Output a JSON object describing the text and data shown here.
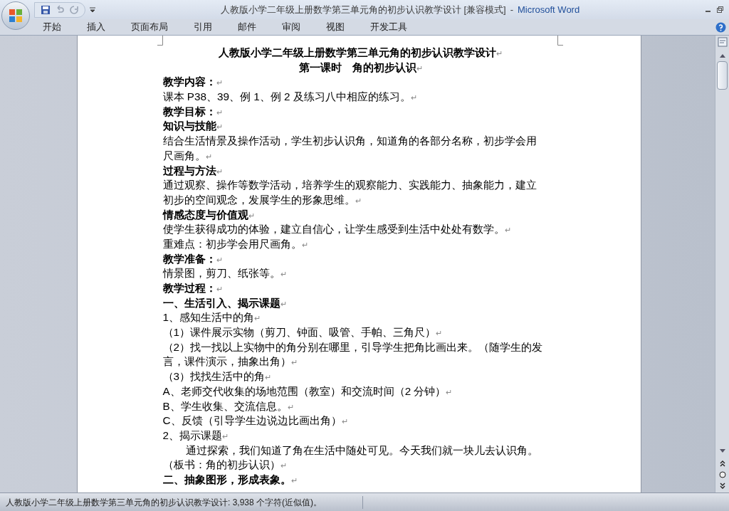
{
  "window": {
    "title": "人教版小学二年级上册数学第三单元角的初步认识教学设计 [兼容模式]",
    "separator": "-",
    "app_name": "Microsoft Word"
  },
  "ribbon_tabs": [
    {
      "label": "开始",
      "selected": false
    },
    {
      "label": "插入",
      "selected": false
    },
    {
      "label": "页面布局",
      "selected": false
    },
    {
      "label": "引用",
      "selected": false
    },
    {
      "label": "邮件",
      "selected": false
    },
    {
      "label": "审阅",
      "selected": false
    },
    {
      "label": "视图",
      "selected": false
    },
    {
      "label": "开发工具",
      "selected": false
    }
  ],
  "document": {
    "paragraphs": [
      {
        "kind": "title",
        "lines": [
          "人教版小学二年级上册数学第三单元角的初步认识教学设计"
        ],
        "mark": "↵"
      },
      {
        "kind": "title",
        "lines": [
          "第一课时　角的初步认识"
        ],
        "mark": "↵"
      },
      {
        "kind": "heading",
        "lines": [
          "教学内容："
        ],
        "mark": "↵"
      },
      {
        "kind": "body",
        "lines": [
          "课本 P38、39、例 1、例 2 及练习八中相应的练习。"
        ],
        "mark": "↵"
      },
      {
        "kind": "heading",
        "lines": [
          "教学目标："
        ],
        "mark": "↵"
      },
      {
        "kind": "heading",
        "lines": [
          "知识与技能"
        ],
        "mark": "↵"
      },
      {
        "kind": "body",
        "lines": [
          "结合生活情景及操作活动，学生初步认识角，知道角的各部分名称，初步学会用",
          "尺画角。"
        ],
        "mark": "↵"
      },
      {
        "kind": "heading",
        "lines": [
          "过程与方法"
        ],
        "mark": "↵"
      },
      {
        "kind": "body",
        "lines": [
          "通过观察、操作等数学活动，培养学生的观察能力、实践能力、抽象能力，建立",
          "初步的空间观念，发展学生的形象思维。"
        ],
        "mark": "↵"
      },
      {
        "kind": "heading",
        "lines": [
          "情感态度与价值观"
        ],
        "mark": "↵"
      },
      {
        "kind": "body",
        "lines": [
          "使学生获得成功的体验，建立自信心，让学生感受到生活中处处有数学。"
        ],
        "mark": "↵"
      },
      {
        "kind": "body",
        "lines": [
          "重难点：初步学会用尺画角。"
        ],
        "mark": "↵"
      },
      {
        "kind": "heading",
        "lines": [
          "教学准备："
        ],
        "mark": "↵"
      },
      {
        "kind": "body",
        "lines": [
          "情景图，剪刀、纸张等。"
        ],
        "mark": "↵"
      },
      {
        "kind": "heading",
        "lines": [
          "教学过程："
        ],
        "mark": "↵"
      },
      {
        "kind": "heading",
        "lines": [
          "一、生活引入、揭示课题"
        ],
        "mark": "↵"
      },
      {
        "kind": "body",
        "lines": [
          "1、感知生活中的角"
        ],
        "mark": "↵"
      },
      {
        "kind": "body",
        "lines": [
          "（1）课件展示实物（剪刀、钟面、吸管、手帕、三角尺）"
        ],
        "mark": "↵"
      },
      {
        "kind": "body",
        "lines": [
          "（2）找一找以上实物中的角分别在哪里，引导学生把角比画出来。（随学生的发",
          "言，课件演示，抽象出角）"
        ],
        "mark": "↵"
      },
      {
        "kind": "body",
        "lines": [
          "（3）找找生活中的角"
        ],
        "mark": "↵"
      },
      {
        "kind": "body",
        "lines": [
          "A、老师交代收集的场地范围（教室）和交流时间（2 分钟）"
        ],
        "mark": "↵"
      },
      {
        "kind": "body",
        "lines": [
          "B、学生收集、交流信息。"
        ],
        "mark": "↵"
      },
      {
        "kind": "body",
        "lines": [
          "C、反馈（引导学生边说边比画出角）"
        ],
        "mark": "↵"
      },
      {
        "kind": "body",
        "lines": [
          "2、揭示课题"
        ],
        "mark": "↵"
      },
      {
        "kind": "indent",
        "lines": [
          "通过探索，我们知道了角在生活中随处可见。今天我们就一块儿去认识角。",
          "（板书：角的初步认识）"
        ],
        "mark": "↵"
      },
      {
        "kind": "heading",
        "lines": [
          "二、抽象图形，形成表象。"
        ],
        "mark": "↵"
      }
    ]
  },
  "status_bar": {
    "text": "人教版小学二年级上册数学第三单元角的初步认识教学设计: 3,938 个字符(近似值)。"
  }
}
